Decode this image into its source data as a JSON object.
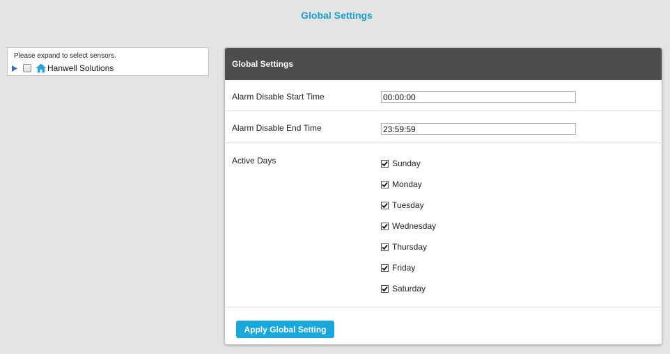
{
  "page": {
    "title": "Global Settings"
  },
  "tree": {
    "hint": "Please expand to select sensors.",
    "root_label": "Hanwell Solutions",
    "root_icon": "home-icon",
    "expander_icon": "triangle-right-icon",
    "root_checked": false
  },
  "panel": {
    "header_title": "Global Settings",
    "start_time_label": "Alarm Disable Start Time",
    "start_time_value": "00:00:00",
    "end_time_label": "Alarm Disable End Time",
    "end_time_value": "23:59:59",
    "active_days_label": "Active Days",
    "days": [
      {
        "label": "Sunday",
        "checked": true
      },
      {
        "label": "Monday",
        "checked": true
      },
      {
        "label": "Tuesday",
        "checked": true
      },
      {
        "label": "Wednesday",
        "checked": true
      },
      {
        "label": "Thursday",
        "checked": true
      },
      {
        "label": "Friday",
        "checked": true
      },
      {
        "label": "Saturday",
        "checked": true
      }
    ],
    "apply_button_label": "Apply Global Setting"
  },
  "colors": {
    "accent": "#1a9fd4",
    "button": "#18a8dc",
    "header_bg": "#4d4d4d",
    "page_bg": "#e4e4e4"
  }
}
